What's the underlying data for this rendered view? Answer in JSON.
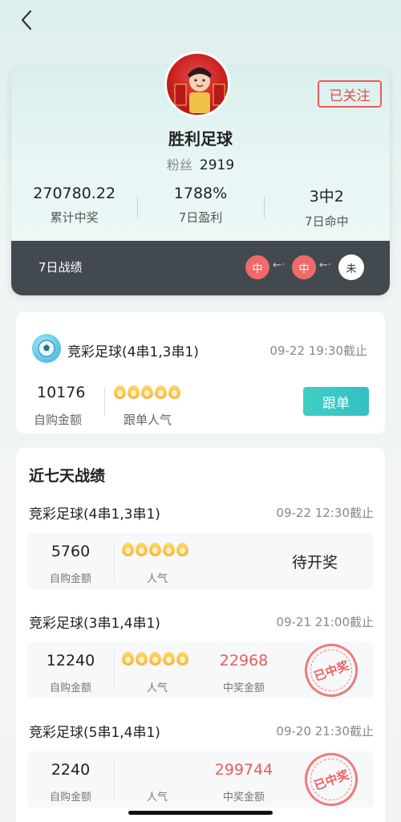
{
  "profile": {
    "name": "胜利足球",
    "fans_label": "粉丝",
    "fans_count": "2919",
    "follow_label": "已关注"
  },
  "stats": [
    {
      "value": "270780.22",
      "label": "累计中奖"
    },
    {
      "value": "1788%",
      "label": "7日盈利"
    },
    {
      "value": "3中2",
      "label": "7日命中"
    }
  ],
  "record": {
    "label": "7日战绩",
    "results": [
      "中",
      "中",
      "未"
    ]
  },
  "current_bet": {
    "title": "竞彩足球(4串1,3串1)",
    "deadline": "09-22 19:30截止",
    "amount": "10176",
    "amount_label": "自购金额",
    "popularity_label": "跟单人气",
    "popularity": 5,
    "action_label": "跟单"
  },
  "history": {
    "title": "近七天战绩",
    "items": [
      {
        "name": "竞彩足球(4串1,3串1)",
        "deadline": "09-22 12:30截止",
        "amount": "5760",
        "amount_label": "自购金额",
        "popularity_label": "人气",
        "popularity": 5,
        "status": "待开奖"
      },
      {
        "name": "竞彩足球(3串1,4串1)",
        "deadline": "09-21 21:00截止",
        "amount": "12240",
        "amount_label": "自购金额",
        "popularity_label": "人气",
        "popularity": 5,
        "win_amount": "22968",
        "win_label": "中奖金额",
        "stamp": "已中奖"
      },
      {
        "name": "竞彩足球(5串1,4串1)",
        "deadline": "09-20 21:30截止",
        "amount": "2240",
        "amount_label": "自购金额",
        "popularity_label": "人气",
        "popularity": 0,
        "win_amount": "299744",
        "win_label": "中奖金额",
        "stamp": "已中奖"
      }
    ]
  },
  "colors": {
    "accent": "#3ecfc4",
    "win_red": "#e85c5c",
    "dark_bar": "#424a4f"
  }
}
